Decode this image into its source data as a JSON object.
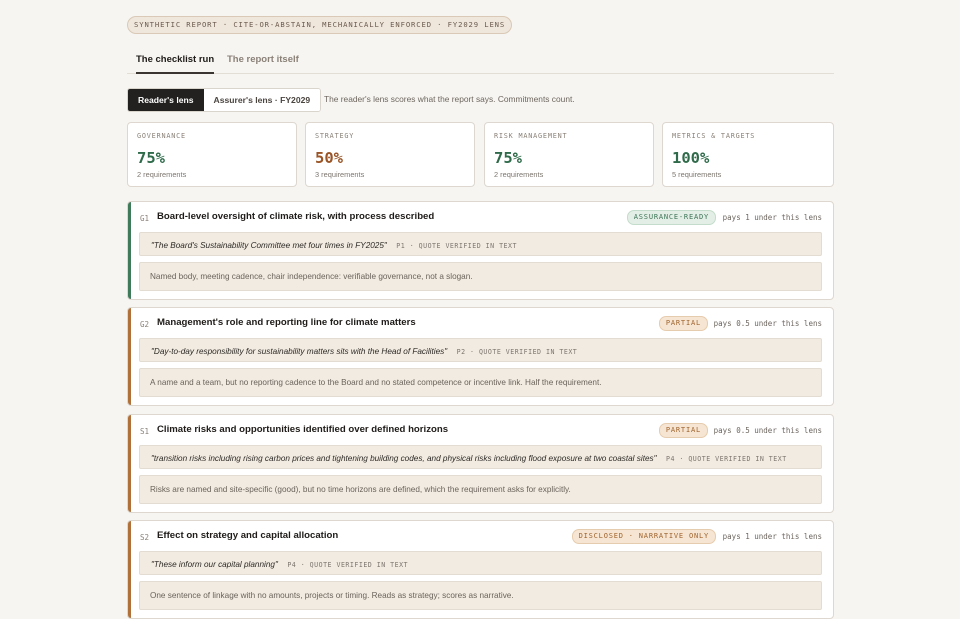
{
  "header": {
    "badge": "SYNTHETIC REPORT · CITE-OR-ABSTAIN, MECHANICALLY ENFORCED · FY2029 LENS"
  },
  "tabs": [
    {
      "label": "The checklist run",
      "active": true
    },
    {
      "label": "The report itself",
      "active": false
    }
  ],
  "lens": {
    "options": [
      {
        "label": "Reader's lens",
        "active": true
      },
      {
        "label": "Assurer's lens · FY2029",
        "active": false
      }
    ],
    "description": "The reader's lens scores what the report says. Commitments count."
  },
  "metrics": [
    {
      "label": "GOVERNANCE",
      "value": "75%",
      "sub": "2 requirements",
      "tone": "green"
    },
    {
      "label": "STRATEGY",
      "value": "50%",
      "sub": "3 requirements",
      "tone": "rust"
    },
    {
      "label": "RISK MANAGEMENT",
      "value": "75%",
      "sub": "2 requirements",
      "tone": "green"
    },
    {
      "label": "METRICS & TARGETS",
      "value": "100%",
      "sub": "5 requirements",
      "tone": "green"
    }
  ],
  "requirements": [
    {
      "id": "G1",
      "title": "Board-level oversight of climate risk, with process described",
      "status": "ASSURANCE-READY",
      "status_kind": "ready",
      "pays": "pays 1 under this lens",
      "quote": "\"The Board's Sustainability Committee met four times in FY2025\"",
      "quote_meta": "P1 · QUOTE VERIFIED IN TEXT",
      "note": "Named body, meeting cadence, chair independence: verifiable governance, not a slogan.",
      "accent": "#3f7a5a"
    },
    {
      "id": "G2",
      "title": "Management's role and reporting line for climate matters",
      "status": "PARTIAL",
      "status_kind": "partial",
      "pays": "pays 0.5 under this lens",
      "quote": "\"Day-to-day responsibility for sustainability matters sits with the Head of Facilities\"",
      "quote_meta": "P2 · QUOTE VERIFIED IN TEXT",
      "note": "A name and a team, but no reporting cadence to the Board and no stated competence or incentive link. Half the requirement.",
      "accent": "#b0703a"
    },
    {
      "id": "S1",
      "title": "Climate risks and opportunities identified over defined horizons",
      "status": "PARTIAL",
      "status_kind": "partial",
      "pays": "pays 0.5 under this lens",
      "quote": "\"transition risks including rising carbon prices and tightening building codes, and physical risks including flood exposure at two coastal sites\"",
      "quote_meta": "P4 · QUOTE VERIFIED IN TEXT",
      "note": "Risks are named and site-specific (good), but no time horizons are defined, which the requirement asks for explicitly.",
      "accent": "#b0703a"
    },
    {
      "id": "S2",
      "title": "Effect on strategy and capital allocation",
      "status": "DISCLOSED · NARRATIVE ONLY",
      "status_kind": "partial",
      "pays": "pays 1 under this lens",
      "quote": "\"These inform our capital planning\"",
      "quote_meta": "P4 · QUOTE VERIFIED IN TEXT",
      "note": "One sentence of linkage with no amounts, projects or timing. Reads as strategy; scores as narrative.",
      "accent": "#b0703a"
    }
  ]
}
